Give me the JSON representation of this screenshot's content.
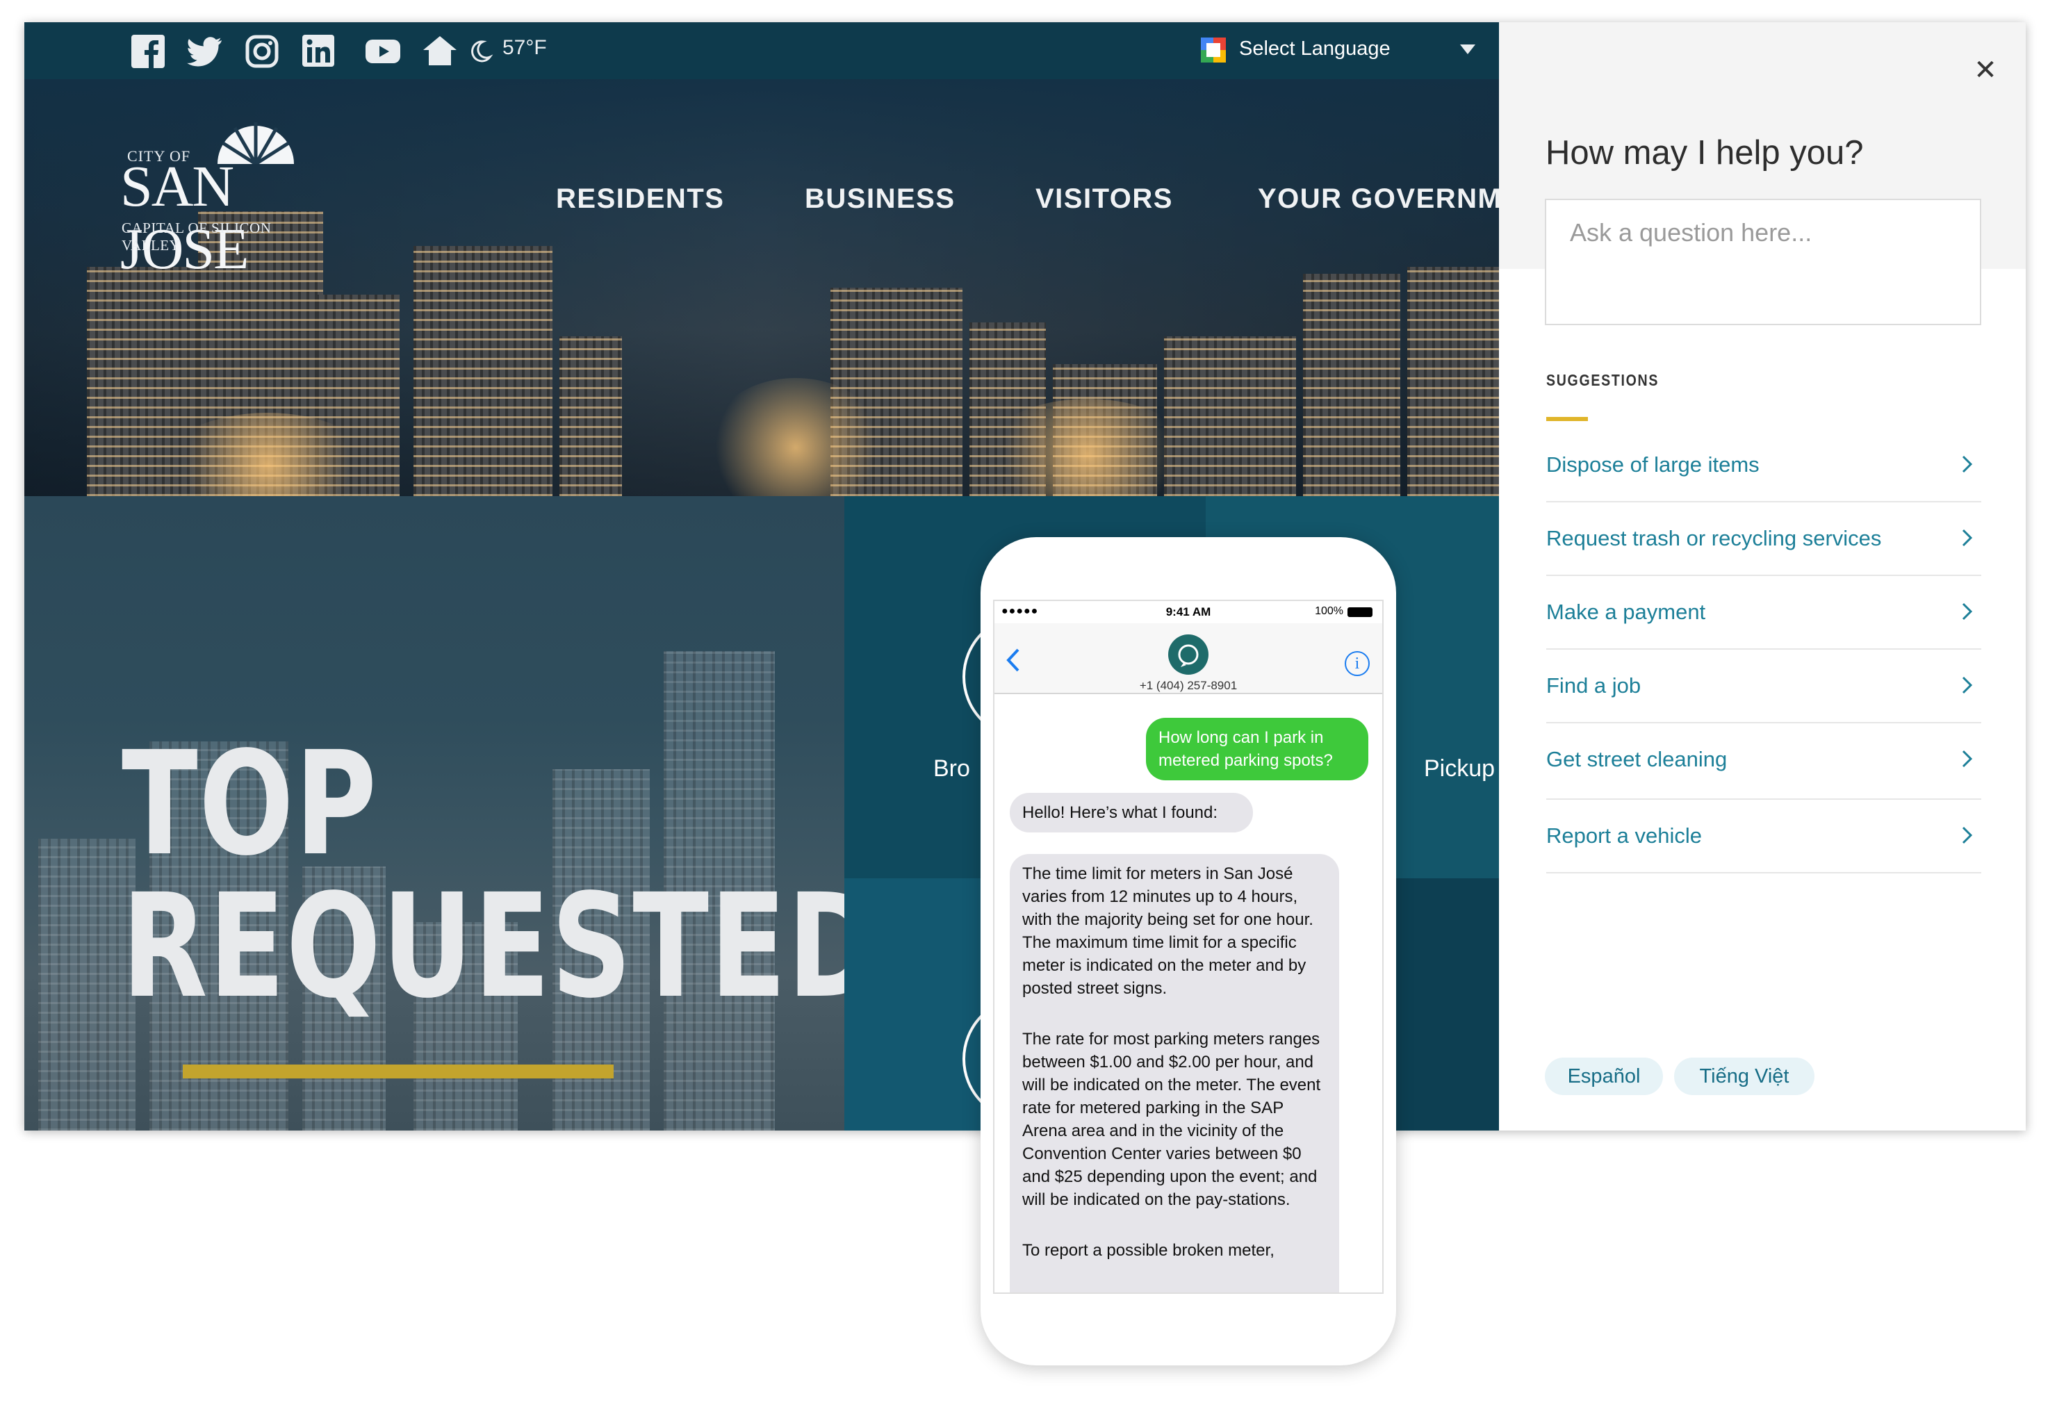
{
  "topbar": {
    "social": [
      "facebook-icon",
      "twitter-icon",
      "instagram-icon",
      "linkedin-icon",
      "youtube-icon",
      "nextdoor-icon"
    ],
    "weather_icon": "moon-icon",
    "temperature": "57°F",
    "language_label": "Select Language"
  },
  "logo": {
    "city_of": "CITY OF",
    "name": "SAN JOSE",
    "tagline": "CAPITAL OF SILICON VALLEY"
  },
  "nav": [
    "RESIDENTS",
    "BUSINESS",
    "VISITORS",
    "YOUR GOVERNM"
  ],
  "hero_section": {
    "title_line1": "TOP",
    "title_line2": "REQUESTED",
    "tile_labels": [
      "Bro",
      "Pickup"
    ]
  },
  "panel": {
    "heading": "How may I help you?",
    "placeholder": "Ask a question here...",
    "suggestions_label": "SUGGESTIONS",
    "suggestions": [
      "Dispose of large items",
      "Request trash or recycling services",
      "Make a payment",
      "Find a job",
      "Get street cleaning",
      "Report a vehicle"
    ],
    "languages": [
      "Español",
      "Tiếng Việt"
    ]
  },
  "phone": {
    "carrier": "●●●●● ",
    "time": "9:41 AM",
    "battery": "100%",
    "contact": "+1 (404) 257-8901",
    "messages": {
      "outgoing": "How long can I park in metered parking spots?",
      "incoming_1": "Hello! Here’s what I found:",
      "incoming_2_p1": "The time limit for meters in San José varies from 12 minutes up to 4 hours, with the majority being set for one hour. The maximum time limit for a specific meter is indicated on the meter and by posted street signs.",
      "incoming_2_p2": "The rate for most parking meters ranges between $1.00 and $2.00 per hour, and will be indicated on the meter. The event rate for metered parking in the SAP Arena area and in the vicinity of the Convention Center varies between $0 and $25 depending upon the event; and will be indicated on the pay-stations.",
      "incoming_2_p3": "To report a possible broken meter,"
    }
  },
  "colors": {
    "topbar": "#0e3a4c",
    "accent_gold": "#c3a42d",
    "link_teal": "#1c7f98",
    "imessage_green": "#3ec93b"
  }
}
